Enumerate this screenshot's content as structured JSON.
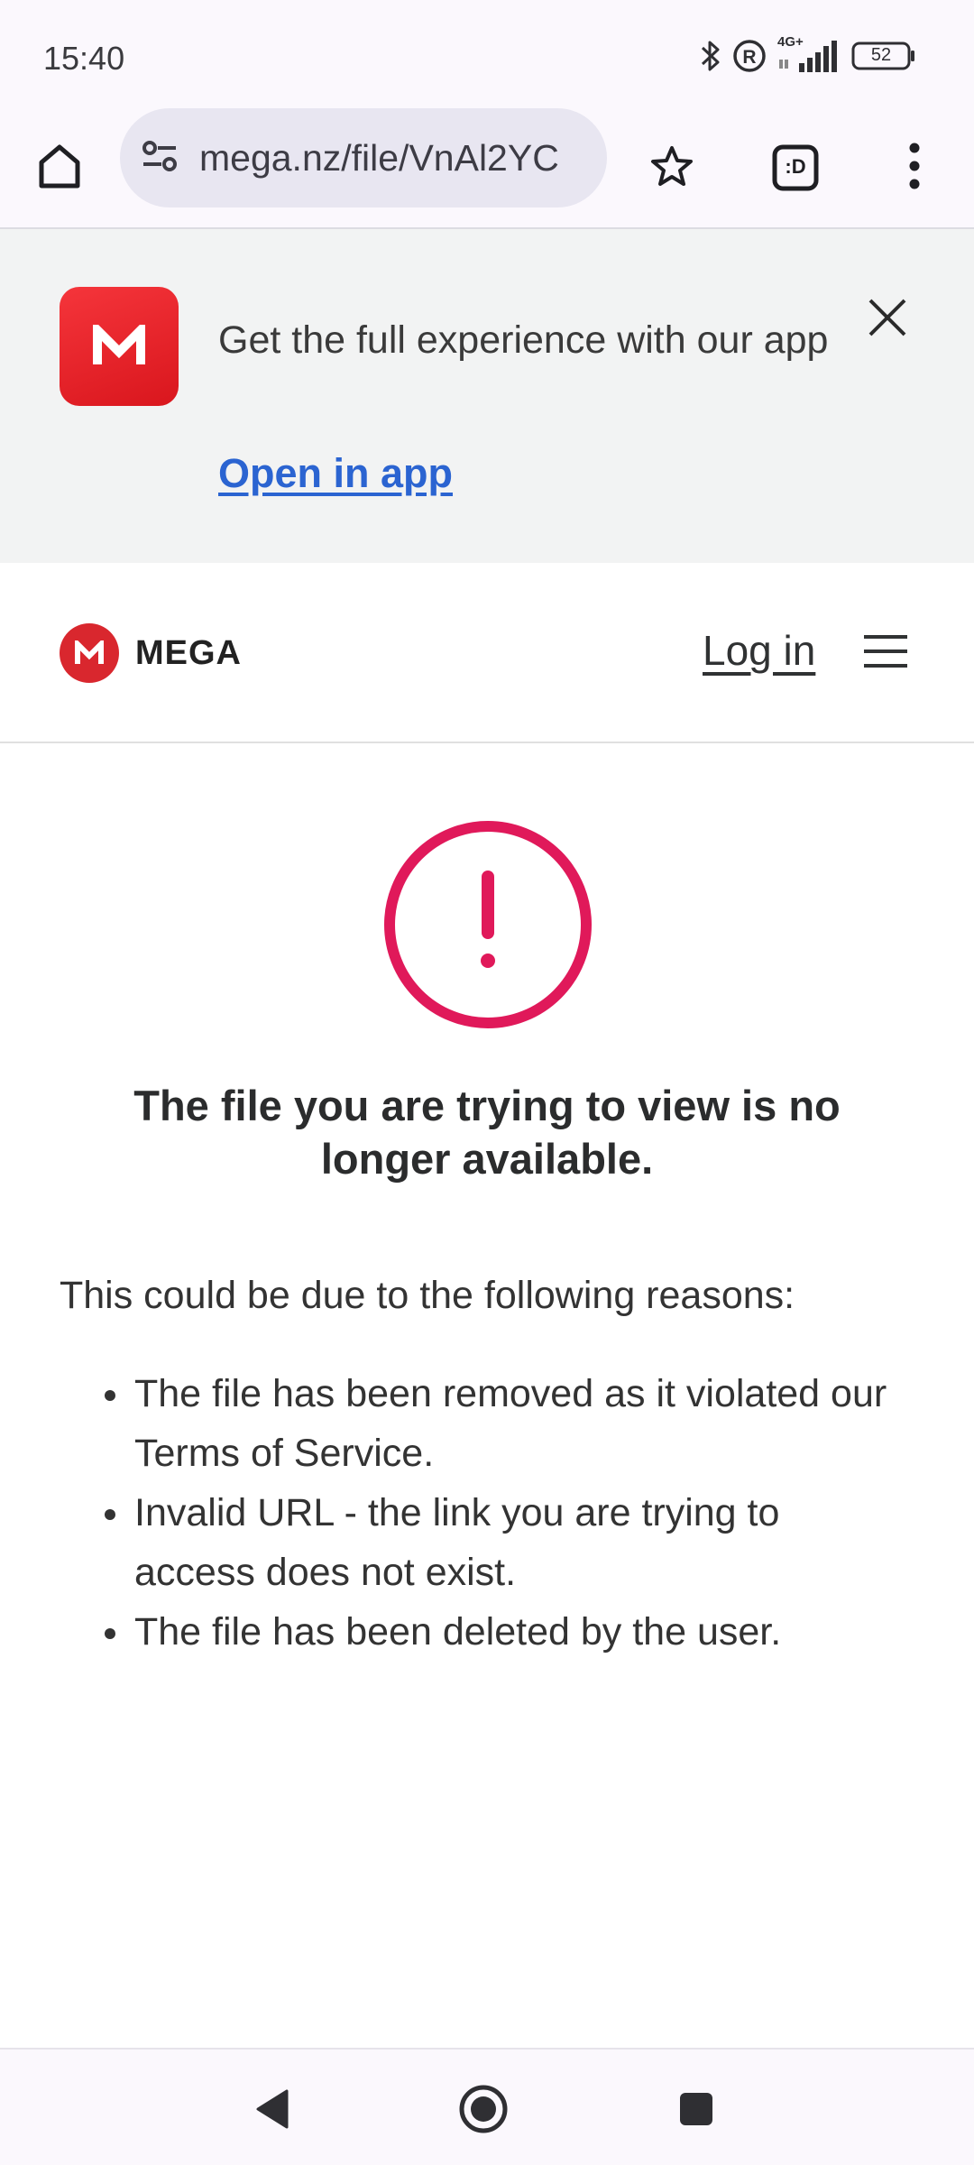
{
  "status_bar": {
    "time": "15:40",
    "network": "4G+",
    "battery": "52",
    "icons": [
      "bluetooth-icon",
      "registered-icon",
      "signal-icon",
      "battery-icon"
    ]
  },
  "browser": {
    "url": "mega.nz/file/VnAl2YC",
    "icons": [
      "home-icon",
      "site-settings-icon",
      "star-icon",
      "tab-switcher-icon",
      "more-vert-icon"
    ],
    "tab_label": ":D"
  },
  "app_banner": {
    "message": "Get the full experience with our app",
    "link_label": "Open in app",
    "app_icon_letter": "M"
  },
  "site_header": {
    "brand": "MEGA",
    "brand_letter": "M",
    "login_label": "Log in"
  },
  "error": {
    "title": "The file you are trying to view is no longer available.",
    "intro": "This could be due to the following reasons:",
    "reasons": [
      "The file has been removed as it violated our Terms of Service.",
      "Invalid URL - the link you are trying to access does not exist.",
      "The file has been deleted by the user."
    ]
  },
  "colors": {
    "brand_red": "#d9272e",
    "error_accent": "#e0195a",
    "link_blue": "#2b64d1",
    "banner_bg": "#f2f3f3"
  }
}
